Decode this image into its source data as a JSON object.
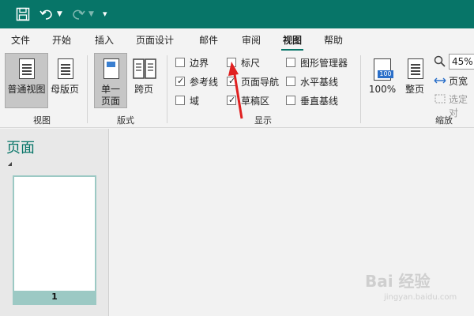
{
  "qat": {
    "save_icon": "save-icon",
    "undo_icon": "undo-icon",
    "redo_icon": "redo-icon",
    "customize_icon": "customize-icon"
  },
  "tabs": [
    "文件",
    "开始",
    "插入",
    "页面设计",
    "邮件",
    "审阅",
    "视图",
    "帮助"
  ],
  "active_tab": "视图",
  "groups": {
    "view": {
      "label": "视图",
      "normal": "普通视图",
      "master": "母版页"
    },
    "layout": {
      "label": "版式",
      "single_line1": "单一",
      "single_line2": "页面",
      "two_page": "跨页"
    },
    "show": {
      "label": "显示",
      "boundaries": "边界",
      "guides": "参考线",
      "fields": "域",
      "rulers": "标尺",
      "page_nav": "页面导航",
      "scratch": "草稿区",
      "graphics_mgr": "图形管理器",
      "baselines_h": "水平基线",
      "baselines_v": "垂直基线"
    },
    "zoom": {
      "label": "缩放",
      "percent": "100%",
      "percent_icon": "100",
      "whole_page": "整页",
      "zoom_value": "45%",
      "page_width": "页宽",
      "selected": "选定对"
    }
  },
  "pane": {
    "title": "页面",
    "page_number": "1"
  },
  "watermark": {
    "main": "Bai 经验",
    "sub": "jingyan.baidu.com"
  },
  "colors": {
    "accent": "#077568",
    "arrow": "#e02020"
  }
}
